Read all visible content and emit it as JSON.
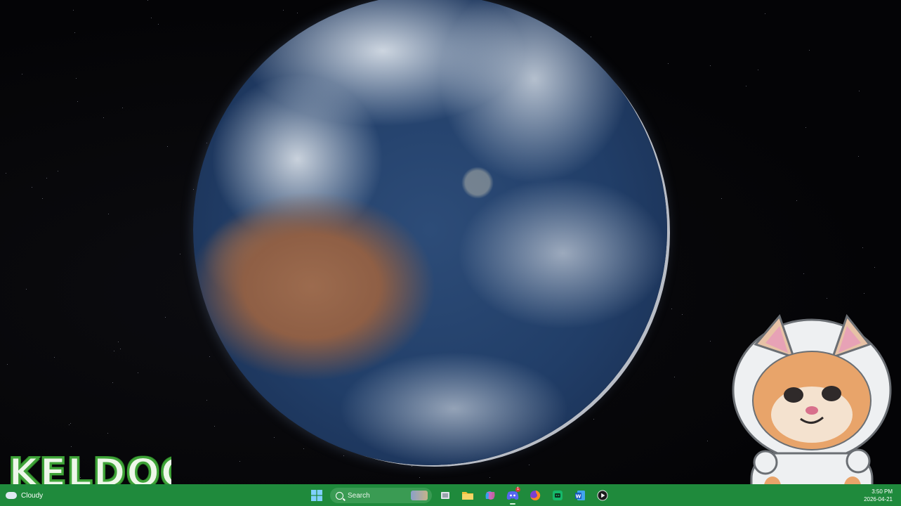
{
  "desktop": {
    "wallpaper": "earth-from-space",
    "logo_text": "KELDOGE"
  },
  "taskbar": {
    "weather": {
      "icon": "cloud-icon",
      "text": "Cloudy"
    },
    "search": {
      "label": "Search"
    },
    "apps": [
      {
        "name": "task-view",
        "icon": "task-view-icon"
      },
      {
        "name": "file-explorer",
        "icon": "folder-icon"
      },
      {
        "name": "copilot",
        "icon": "copilot-icon"
      },
      {
        "name": "discord",
        "icon": "discord-icon",
        "active": true,
        "badge": "1"
      },
      {
        "name": "firefox",
        "icon": "firefox-icon"
      },
      {
        "name": "chat-app",
        "icon": "chat-icon"
      },
      {
        "name": "word",
        "icon": "word-icon"
      },
      {
        "name": "media-player",
        "icon": "play-icon"
      }
    ],
    "clock": {
      "time": "3:50 PM",
      "date": "2026-04-21"
    },
    "colors": {
      "taskbar": "#1f8a3c",
      "logo_outline": "#3fa338"
    }
  }
}
